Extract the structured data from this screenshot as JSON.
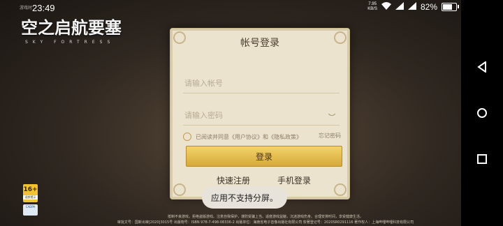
{
  "status": {
    "clock": "23:49",
    "small_label": "游戏时",
    "net_speed_value": "7.95",
    "net_speed_unit": "KB/S",
    "battery": "82%",
    "battery_level": 0.82
  },
  "logo": {
    "title": "空之启航要塞",
    "subtitle": "SKY FORTRESS"
  },
  "login": {
    "title": "帐号登录",
    "account_placeholder": "请输入帐号",
    "password_placeholder": "请输入密码",
    "agree_prefix": "已阅读并同意",
    "user_agreement": "《用户协议》",
    "and": "和",
    "privacy_policy": "《隐私政策》",
    "forgot_password": "忘记密码",
    "login_button": "登录",
    "quick_register": "快速注册",
    "phone_login": "手机登录"
  },
  "toast": "应用不支持分屏。",
  "age_rating": {
    "label": "16+",
    "caption": "适龄提示"
  },
  "cadpa_label": "CADPA",
  "footer": {
    "line1": "抵制不良游戏，拒绝盗版游戏。注意自我保护，谨防受骗上当。适度游戏益脑，沉迷游戏伤身。合理安排时间，享受健康生活。",
    "line2": "审批文号：国新出审[2020]3015号  出版物号：ISBN 978-7-498-08336-2  出版单位：海南省电子音像出版社有限公司  软著登记号：2020SR0291116  著作权人：上海哔哩哔哩科技有限公司"
  }
}
